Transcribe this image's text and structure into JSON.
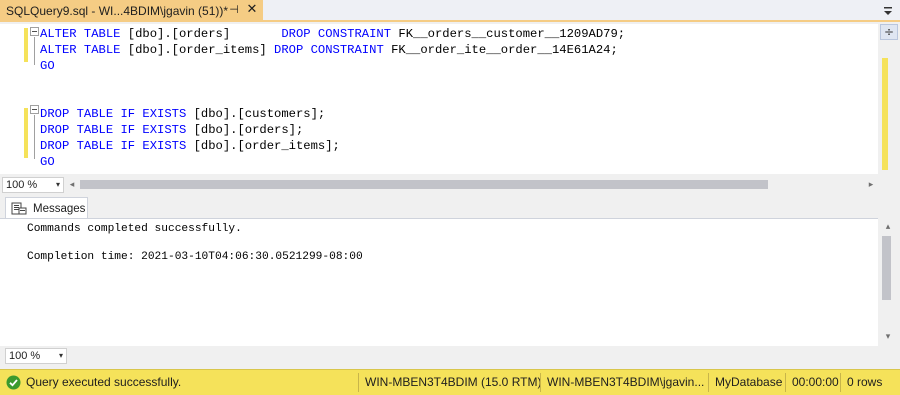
{
  "tab": {
    "title": "SQLQuery9.sql - WI...4BDIM\\jgavin (51))*",
    "pin_glyph": "⊣",
    "close_glyph": "✕"
  },
  "editor": {
    "lines": [
      [
        {
          "t": "ALTER TABLE",
          "k": 1
        },
        {
          "t": " [dbo].[orders]       "
        },
        {
          "t": "DROP CONSTRAINT",
          "k": 1
        },
        {
          "t": " FK__orders__customer__1209AD79;"
        }
      ],
      [
        {
          "t": "ALTER TABLE",
          "k": 1
        },
        {
          "t": " [dbo].[order_items] "
        },
        {
          "t": "DROP CONSTRAINT",
          "k": 1
        },
        {
          "t": " FK__order_ite__order__14E61A24;"
        }
      ],
      [
        {
          "t": "GO",
          "k": 1
        }
      ],
      [],
      [],
      [
        {
          "t": "DROP TABLE IF EXISTS",
          "k": 1
        },
        {
          "t": " [dbo].[customers];"
        }
      ],
      [
        {
          "t": "DROP TABLE IF EXISTS",
          "k": 1
        },
        {
          "t": " [dbo].[orders];"
        }
      ],
      [
        {
          "t": "DROP TABLE IF EXISTS",
          "k": 1
        },
        {
          "t": " [dbo].[order_items];"
        }
      ],
      [
        {
          "t": "GO",
          "k": 1
        }
      ]
    ],
    "split_glyph": "÷"
  },
  "zoom": {
    "value": "100 %",
    "arrow": "▾"
  },
  "scroll": {
    "left": "◂",
    "right": "▸",
    "up": "▴",
    "down": "▾"
  },
  "results": {
    "tab_label": "Messages",
    "messages": [
      "Commands completed successfully.",
      "",
      "Completion time: 2021-03-10T04:06:30.0521299-08:00"
    ]
  },
  "zoom2": {
    "value": "100 %",
    "arrow": "▾"
  },
  "status": {
    "message": "Query executed successfully.",
    "server": "WIN-MBEN3T4BDIM (15.0 RTM)",
    "user": "WIN-MBEN3T4BDIM\\jgavin...",
    "database": "MyDatabase",
    "elapsed": "00:00:00",
    "rows": "0 rows"
  },
  "colors": {
    "accent_tab": "#f5cc84",
    "status_bar": "#f5e25a",
    "keyword": "#0000ff",
    "success": "#3c9a2e"
  }
}
